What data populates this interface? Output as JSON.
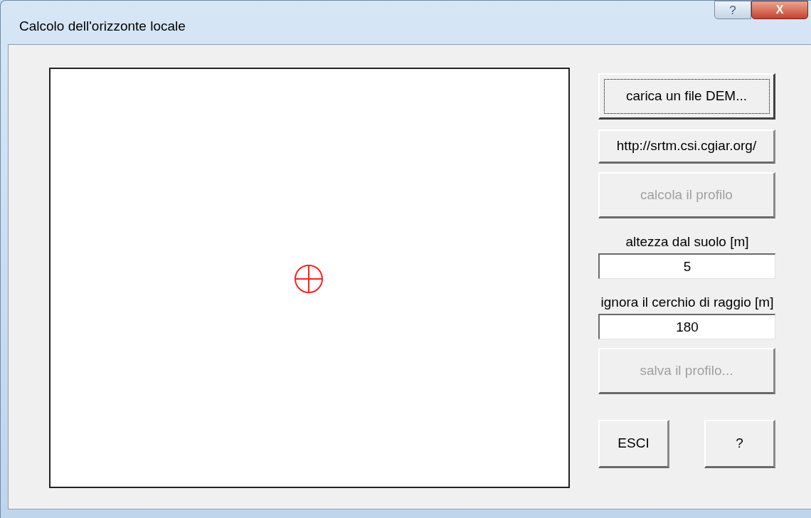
{
  "window": {
    "title": "Calcolo dell'orizzonte locale",
    "title_buttons": [
      {
        "kind": "help",
        "label": "?"
      },
      {
        "kind": "close",
        "label": "X"
      }
    ]
  },
  "canvas": {
    "marker_visible": true
  },
  "controls": [
    {
      "kind": "button",
      "label": "carica un file DEM...",
      "disabled": false,
      "focused": true,
      "tall": true
    },
    {
      "kind": "button",
      "label": "http://srtm.csi.cgiar.org/",
      "disabled": false,
      "focused": false,
      "tall": false
    },
    {
      "kind": "button",
      "label": "calcola il profilo",
      "disabled": true,
      "focused": false,
      "tall": true
    },
    {
      "kind": "field",
      "label": "altezza dal suolo [m]",
      "value": "5"
    },
    {
      "kind": "field",
      "label": "ignora il cerchio di raggio [m]",
      "value": "180"
    },
    {
      "kind": "button",
      "label": "salva il profilo...",
      "disabled": true,
      "focused": false,
      "tall": true
    }
  ],
  "bottom_buttons": [
    {
      "label": "ESCI"
    },
    {
      "label": "?"
    }
  ]
}
